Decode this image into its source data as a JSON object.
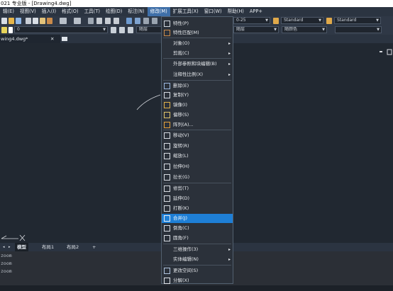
{
  "window": {
    "title": "021 专业版 - [Drawing4.dwg]"
  },
  "menubar": [
    "辑(E)",
    "视图(V)",
    "插入(I)",
    "格式(O)",
    "工具(T)",
    "绘图(D)",
    "标注(N)",
    "修改(M)",
    "扩展工具(X)",
    "窗口(W)",
    "帮助(H)",
    "APP+"
  ],
  "toolbar": {
    "combo_style": "0-25",
    "combo_text_style": "Standard",
    "combo_dim_style": "Standard",
    "combo_layer": "0",
    "combo_color": "随层",
    "combo_linetype": "随层",
    "combo_lineweight": "随颜色"
  },
  "document_tab": {
    "label": "wing4.dwg*",
    "close": "✕"
  },
  "layout_tabs": [
    "模型",
    "布局1",
    "布局2",
    "+"
  ],
  "command_history": [
    "zoom",
    "zoom",
    "zoom"
  ],
  "modify_menu": {
    "items": [
      {
        "label": "特性(P)",
        "icon": "properties-icon",
        "submenu": false,
        "highlight": false
      },
      {
        "label": "特性匹配(M)",
        "icon": "match-properties-icon",
        "submenu": false,
        "highlight": false
      },
      {
        "label": "对象(O)",
        "icon": "",
        "submenu": true,
        "highlight": false
      },
      {
        "label": "剪裁(C)",
        "icon": "",
        "submenu": true,
        "highlight": false
      },
      {
        "label": "外部参照和块编辑(B)",
        "icon": "",
        "submenu": true,
        "highlight": false
      },
      {
        "label": "注释性比例(X)",
        "icon": "",
        "submenu": true,
        "highlight": false
      },
      {
        "label": "删除(E)",
        "icon": "erase-icon",
        "submenu": false,
        "highlight": false
      },
      {
        "label": "复制(Y)",
        "icon": "copy-icon",
        "submenu": false,
        "highlight": false
      },
      {
        "label": "镜像(I)",
        "icon": "mirror-icon",
        "submenu": false,
        "highlight": false
      },
      {
        "label": "偏移(S)",
        "icon": "offset-icon",
        "submenu": false,
        "highlight": false
      },
      {
        "label": "阵列(A)...",
        "icon": "array-icon",
        "submenu": false,
        "highlight": false
      },
      {
        "label": "移动(V)",
        "icon": "move-icon",
        "submenu": false,
        "highlight": false
      },
      {
        "label": "旋转(R)",
        "icon": "rotate-icon",
        "submenu": false,
        "highlight": false
      },
      {
        "label": "缩放(L)",
        "icon": "scale-icon",
        "submenu": false,
        "highlight": false
      },
      {
        "label": "拉伸(H)",
        "icon": "stretch-icon",
        "submenu": false,
        "highlight": false
      },
      {
        "label": "拉长(G)",
        "icon": "lengthen-icon",
        "submenu": false,
        "highlight": false
      },
      {
        "label": "修剪(T)",
        "icon": "trim-icon",
        "submenu": false,
        "highlight": false
      },
      {
        "label": "延伸(D)",
        "icon": "extend-icon",
        "submenu": false,
        "highlight": false
      },
      {
        "label": "打断(K)",
        "icon": "break-icon",
        "submenu": false,
        "highlight": false
      },
      {
        "label": "合并(J)",
        "icon": "join-icon",
        "submenu": false,
        "highlight": true
      },
      {
        "label": "倒角(C)",
        "icon": "chamfer-icon",
        "submenu": false,
        "highlight": false
      },
      {
        "label": "圆角(F)",
        "icon": "fillet-icon",
        "submenu": false,
        "highlight": false
      },
      {
        "label": "三维操作(3)",
        "icon": "",
        "submenu": true,
        "highlight": false
      },
      {
        "label": "实体编辑(N)",
        "icon": "",
        "submenu": true,
        "highlight": false
      },
      {
        "label": "更改空间(S)",
        "icon": "change-space-icon",
        "submenu": false,
        "highlight": false
      },
      {
        "label": "分解(X)",
        "icon": "explode-icon",
        "submenu": false,
        "highlight": false
      }
    ],
    "submenu_arrow": "▸"
  }
}
